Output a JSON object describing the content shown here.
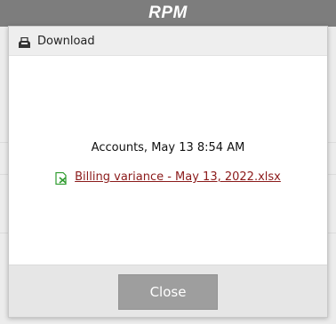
{
  "app": {
    "title": "RPM"
  },
  "dialog": {
    "title": "Download",
    "header_icon": "download-tray-icon",
    "message": "Accounts, May 13 8:54 AM",
    "file": {
      "icon": "excel-file-icon",
      "name": "Billing variance - May 13, 2022.xlsx"
    },
    "close_label": "Close"
  },
  "colors": {
    "app_bar": "#7d7d7d",
    "link": "#8b1a1a",
    "excel_icon": "#2e9b2e",
    "close_button": "#9e9e9e"
  }
}
